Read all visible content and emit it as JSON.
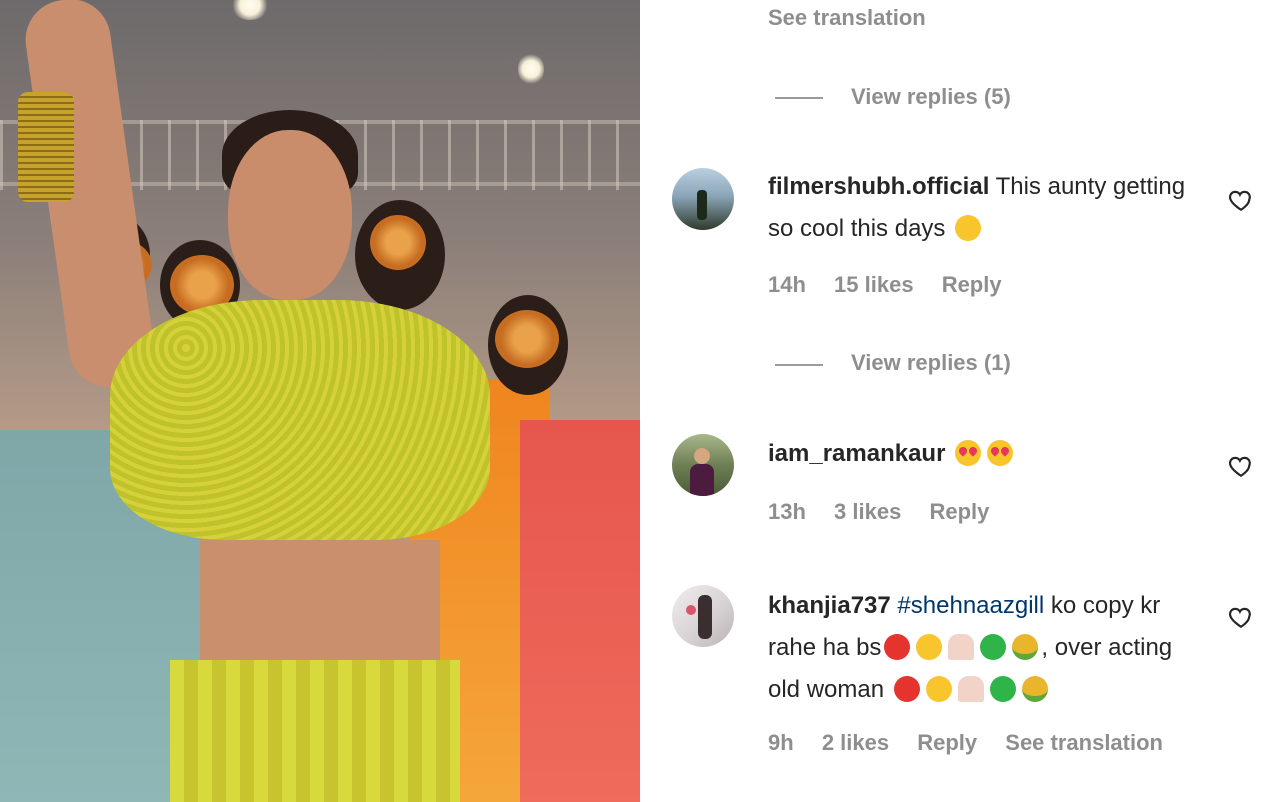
{
  "comments_panel": {
    "top_see_translation": "See translation",
    "view_replies_1": "View replies (5)",
    "view_replies_2": "View replies (1)",
    "comments": [
      {
        "username": "filmershubh.official",
        "text": "This aunty getting so cool this days",
        "emojis": [
          "face-with-tears-of-joy"
        ],
        "time": "14h",
        "likes": "15 likes",
        "reply": "Reply"
      },
      {
        "username": "iam_ramankaur",
        "text": "",
        "emojis": [
          "smiling-face-with-heart-eyes",
          "smiling-face-with-heart-eyes"
        ],
        "time": "13h",
        "likes": "3 likes",
        "reply": "Reply"
      },
      {
        "username": "khanjia737",
        "hashtag": "#shehnaazgill",
        "text_part1": "ko copy kr rahe ha bs",
        "text_part2": ", over acting old woman",
        "emojis": [
          "pouting-face",
          "smirking-face",
          "woman-gesturing-no",
          "nauseated-face",
          "face-vomiting"
        ],
        "time": "9h",
        "likes": "2 likes",
        "reply": "Reply",
        "see_translation": "See translation"
      }
    ]
  },
  "icons": {
    "like": "heart-outline-icon"
  },
  "colors": {
    "text": "#262626",
    "secondary": "#8e8e8e",
    "hashtag": "#00376b"
  }
}
